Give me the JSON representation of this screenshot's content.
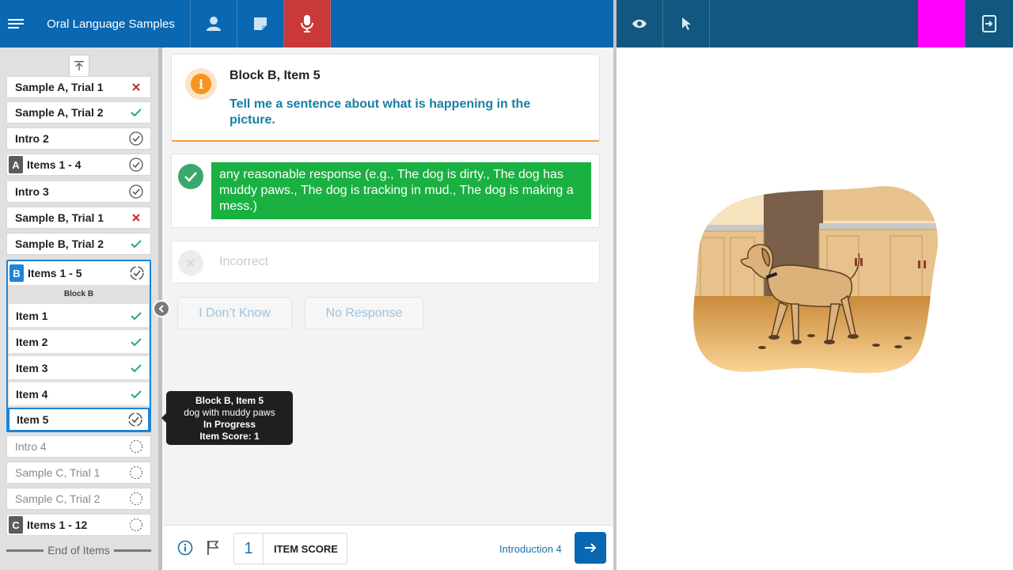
{
  "app": {
    "title": "Oral Language Samples"
  },
  "colors": {
    "primary": "#0a67b1",
    "mic_active": "#c93939",
    "correct": "#1ab042",
    "accent_orange": "#f29b3b",
    "question_text": "#167fa3"
  },
  "topbar": {
    "menu_icon": "hamburger-icon",
    "buttons": [
      "student-icon",
      "notes-icon",
      "microphone-icon"
    ],
    "right_buttons": [
      "eye-icon",
      "pointer-icon",
      "exit-to-device-icon"
    ]
  },
  "sidebar": {
    "items_before": [
      {
        "label": "Sample A, Trial 1",
        "status": "incorrect"
      },
      {
        "label": "Sample A, Trial 2",
        "status": "correct"
      },
      {
        "label": "Intro 2",
        "status": "complete"
      },
      {
        "label": "Items 1 - 4",
        "badge": "A",
        "status": "complete"
      },
      {
        "label": "Intro 3",
        "status": "complete"
      },
      {
        "label": "Sample B, Trial 1",
        "status": "incorrect"
      },
      {
        "label": "Sample B, Trial 2",
        "status": "correct"
      }
    ],
    "active_block": {
      "badge": "B",
      "label": "Items 1 - 5",
      "sub_label": "Block B",
      "items": [
        {
          "label": "Item 1",
          "status": "correct"
        },
        {
          "label": "Item 2",
          "status": "correct"
        },
        {
          "label": "Item 3",
          "status": "correct"
        },
        {
          "label": "Item 4",
          "status": "correct"
        },
        {
          "label": "Item 5",
          "status": "in-progress"
        }
      ]
    },
    "items_after": [
      {
        "label": "Intro 4",
        "status": "not-started"
      },
      {
        "label": "Sample C, Trial 1",
        "status": "not-started"
      },
      {
        "label": "Sample C, Trial 2",
        "status": "not-started"
      },
      {
        "label": "Items 1 - 12",
        "badge": "C",
        "status": "not-started"
      }
    ],
    "end_label": "End of Items"
  },
  "tooltip": {
    "title": "Block B, Item 5",
    "description": "dog with muddy paws",
    "status": "In Progress",
    "score": "Item Score: 1"
  },
  "question": {
    "title": "Block B, Item 5",
    "prompt": "Tell me a sentence about what is happening in the picture."
  },
  "responses": {
    "correct_text": "any reasonable response (e.g., The dog is dirty., The dog has muddy paws., The dog is tracking in mud., The dog is making a mess.)",
    "incorrect_label": "Incorrect",
    "dont_know": "I Don’t Know",
    "no_response": "No Response"
  },
  "footer": {
    "score_value": "1",
    "score_label": "ITEM SCORE",
    "next_label": "Introduction 4"
  }
}
